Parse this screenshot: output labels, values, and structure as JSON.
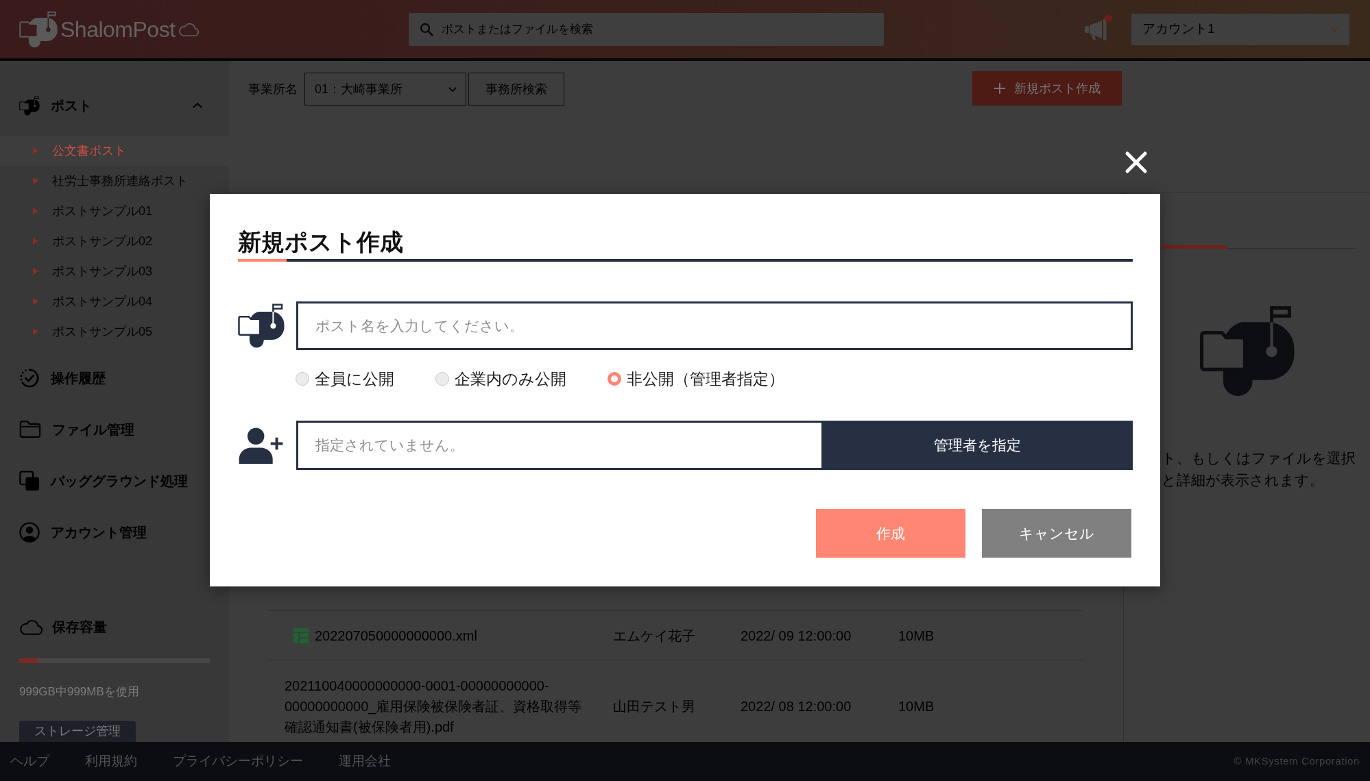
{
  "header": {
    "logo": "ShalomPost",
    "search": {
      "placeholder": "ポストまたはファイルを検索"
    },
    "notifications": {
      "unread": true
    },
    "account": {
      "value": "アカウント1"
    }
  },
  "sidebar": {
    "sections": [
      {
        "label": "ポスト",
        "expanded": true,
        "children": [
          {
            "label": "公文書ポスト",
            "selected": true
          },
          {
            "label": "社労士事務所連絡ポスト",
            "selected": false
          },
          {
            "label": "ポストサンプル01",
            "selected": false
          },
          {
            "label": "ポストサンプル02",
            "selected": false
          },
          {
            "label": "ポストサンプル03",
            "selected": false
          },
          {
            "label": "ポストサンプル04",
            "selected": false
          },
          {
            "label": "ポストサンプル05",
            "selected": false
          }
        ]
      },
      {
        "label": "操作履歴"
      },
      {
        "label": "ファイル管理"
      },
      {
        "label": "バッググラウンド処理"
      },
      {
        "label": "アカウント管理"
      }
    ],
    "storage": {
      "label": "保存容量",
      "level": 0.1,
      "usage": "999GB中999MBを使用",
      "button": "ストレージ管理"
    }
  },
  "toolbar": {
    "office_label": "事業所名",
    "office_select": {
      "value": "01：大崎事業所"
    },
    "office_search_button": "事務所検索",
    "new_post_button": "新規ポスト作成"
  },
  "file_table": {
    "rows": [
      {
        "kind": "spreadsheet",
        "name": "202207050000000000.xml",
        "owner": "エムケイ花子",
        "date": "2022/ 09 12:00:00",
        "size": "10MB"
      },
      {
        "kind": "document",
        "name": "202110040000000000-0001-00000000000-00000000000_雇用保険被保険者証、資格取得等確認通知書(被保険者用).pdf",
        "owner": "山田テスト男",
        "date": "2022/ 08 12:00:00",
        "size": "10MB"
      }
    ]
  },
  "detail_panel": {
    "message_lines": [
      "ト、もしくはファイルを選択",
      "と詳細が表示されます。"
    ]
  },
  "modal": {
    "title": "新規ポスト作成",
    "name_field": {
      "placeholder": "ポスト名を入力してください。"
    },
    "visibility_options": [
      {
        "label": "全員に公開",
        "selected": false
      },
      {
        "label": "企業内のみ公開",
        "selected": false
      },
      {
        "label": "非公開（管理者指定）",
        "selected": true
      }
    ],
    "admin_field": {
      "placeholder": "指定されていません。"
    },
    "admin_button": "管理者を指定",
    "buttons": [
      {
        "label": "作成",
        "kind": "primary"
      },
      {
        "label": "キャンセル",
        "kind": "secondary"
      }
    ]
  },
  "footer": {
    "links": [
      "ヘルプ",
      "利用規約",
      "プライバシーポリシー",
      "運用会社"
    ],
    "copyright": "© MKSystem Corporation"
  }
}
